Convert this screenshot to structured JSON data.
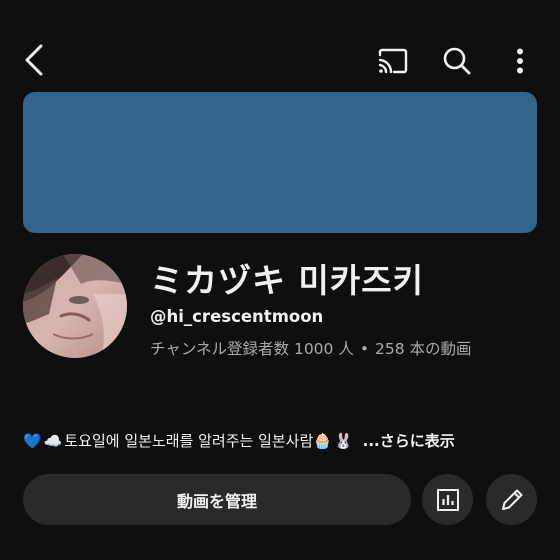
{
  "topbar": {
    "back_icon": "chevron-left-icon",
    "cast_icon": "cast-icon",
    "search_icon": "search-icon",
    "more_icon": "more-vertical-icon"
  },
  "banner": {
    "color": "#32648c"
  },
  "channel": {
    "name": "ミカヅキ 미카즈키",
    "handle": "@hi_crescentmoon",
    "subscribers": "チャンネル登録者数 1000 人",
    "separator": "•",
    "videos": "258 本の動画"
  },
  "description": {
    "emoji_heart": "💙",
    "emoji_cloud": "☁️",
    "text": "토요일에 일본노래를 알려주는 일본사람",
    "emoji_cupcake": "🧁",
    "emoji_rabbit": "🐰",
    "more_label": "...さらに表示"
  },
  "actions": {
    "manage_label": "動画を管理",
    "analytics_icon": "bar-chart-icon",
    "edit_icon": "pencil-icon"
  }
}
